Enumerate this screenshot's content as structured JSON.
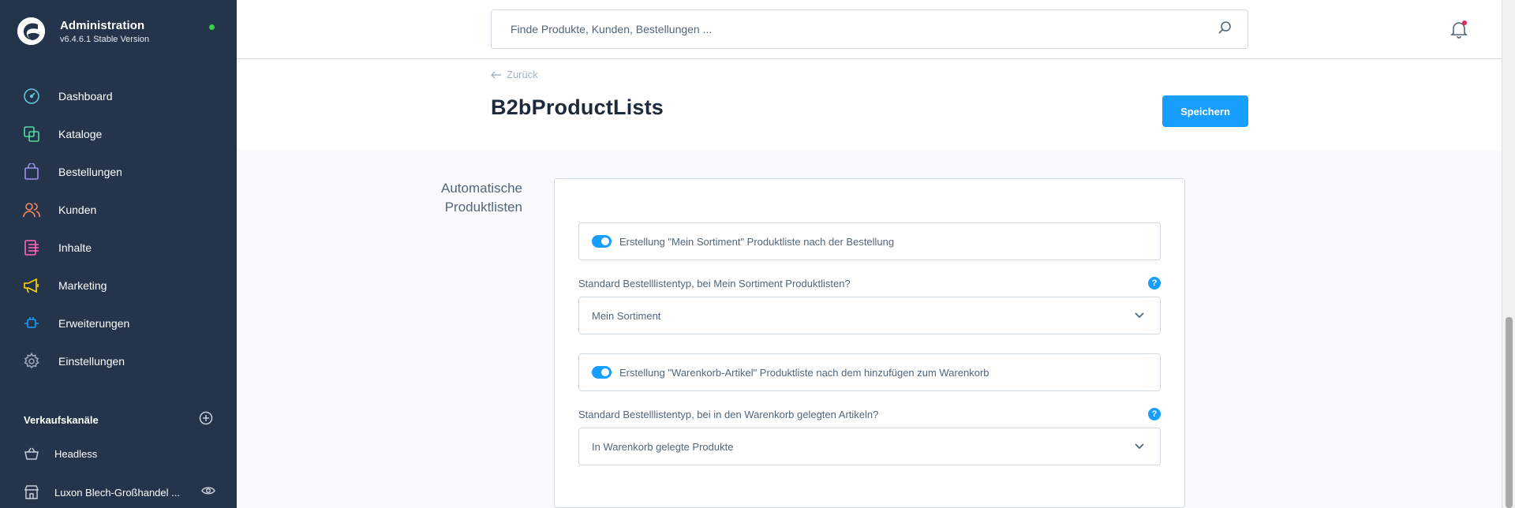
{
  "sidebar": {
    "title": "Administration",
    "version": "v6.4.6.1 Stable Version",
    "items": [
      {
        "label": "Dashboard",
        "icon": "dashboard-icon"
      },
      {
        "label": "Kataloge",
        "icon": "catalog-icon"
      },
      {
        "label": "Bestellungen",
        "icon": "shopping-bag-icon"
      },
      {
        "label": "Kunden",
        "icon": "users-icon"
      },
      {
        "label": "Inhalte",
        "icon": "content-icon"
      },
      {
        "label": "Marketing",
        "icon": "megaphone-icon"
      },
      {
        "label": "Erweiterungen",
        "icon": "plug-icon"
      },
      {
        "label": "Einstellungen",
        "icon": "gear-icon"
      }
    ],
    "sales_channels": {
      "title": "Verkaufskanäle",
      "items": [
        {
          "label": "Headless",
          "icon": "basket-icon"
        },
        {
          "label": "Luxon Blech-Großhandel ...",
          "icon": "storefront-icon"
        }
      ]
    }
  },
  "topbar": {
    "search_placeholder": "Finde Produkte, Kunden, Bestellungen ..."
  },
  "page": {
    "back_label": "Zurück",
    "title": "B2bProductLists",
    "save_label": "Speichern"
  },
  "section": {
    "label": "Automatische Produktlisten",
    "toggle1_label": "Erstellung \"Mein Sortiment\" Produktliste nach der Bestellung",
    "toggle1_on": true,
    "field1_label": "Standard Bestelllistentyp, bei Mein Sortiment Produktlisten?",
    "field1_value": "Mein Sortiment",
    "toggle2_label": "Erstellung \"Warenkorb-Artikel\" Produktliste nach dem hinzufügen zum Warenkorb",
    "toggle2_on": true,
    "field2_label": "Standard Bestelllistentyp, bei in den Warenkorb gelegten Artikeln?",
    "field2_value": "In Warenkorb gelegte Produkte",
    "help_glyph": "?"
  },
  "colors": {
    "sidebar_bg": "#24344a",
    "accent": "#189eff",
    "status_online": "#37d046",
    "notification": "#de294c"
  }
}
